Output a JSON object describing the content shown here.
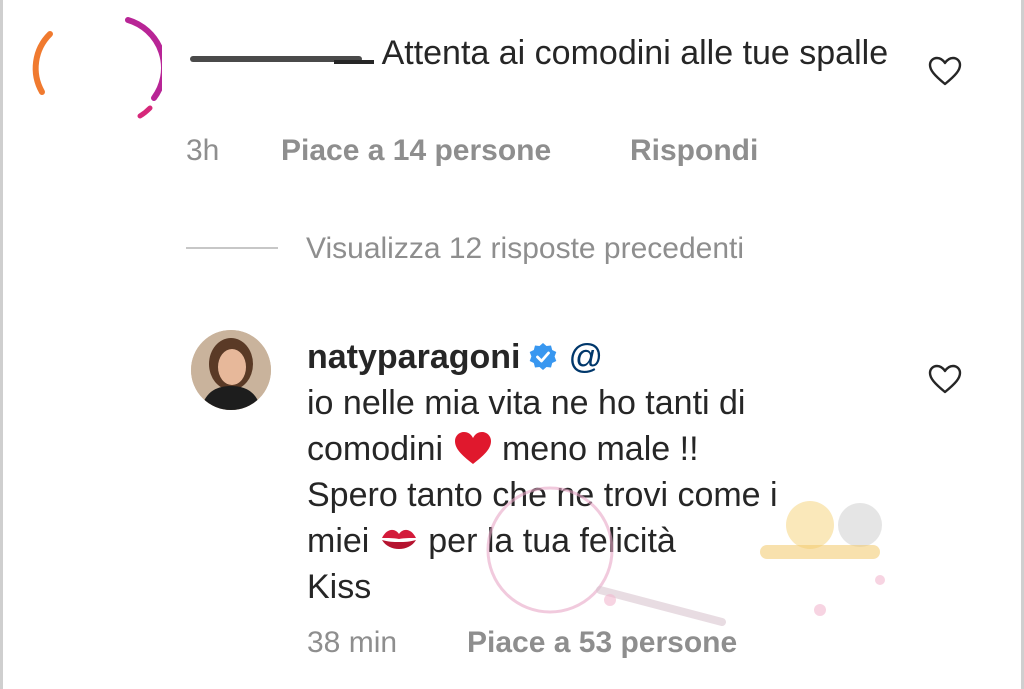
{
  "comment": {
    "text_after_user": "Attenta ai comodini alle tue spalle",
    "time": "3h",
    "likes": "Piace a 14 persone",
    "reply_label": "Rispondi"
  },
  "replies_link": "Visualizza 12 risposte precedenti",
  "reply": {
    "username": "natyparagoni",
    "mention_prefix": "@",
    "line1": "io nelle mia vita ne ho tanti di",
    "line2a": "comodini",
    "line2b": "meno male !!",
    "line3": "Spero tanto che ne trovi come i",
    "line4a": "miei",
    "line4b": "per la tua felicità",
    "line5": "Kiss",
    "time": "38 min",
    "likes": "Piace a 53 persone"
  },
  "icons": {
    "like": "heart-outline-icon",
    "verified": "verified-badge-icon",
    "emoji_heart": "red-heart-emoji",
    "emoji_kiss": "kiss-mark-emoji"
  },
  "colors": {
    "text": "#262626",
    "meta": "#8e8e8e",
    "verified": "#3897f0",
    "mention": "#00376b"
  }
}
